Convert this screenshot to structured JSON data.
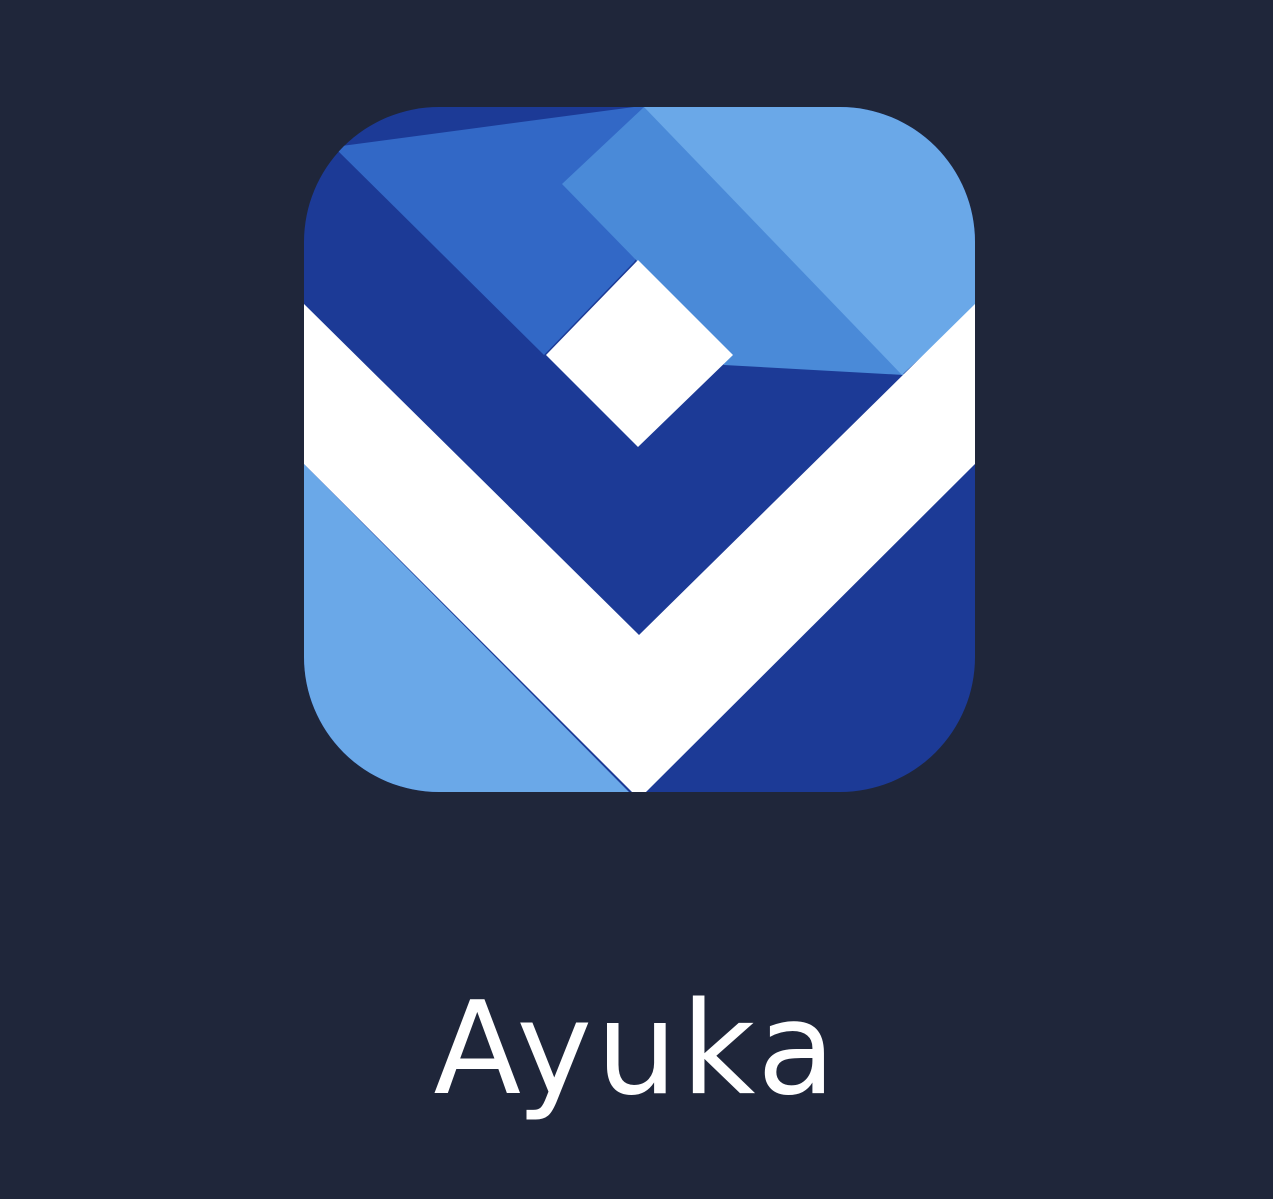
{
  "app": {
    "name": "Ayuka",
    "icon": "ayuka-chevron-logo-icon"
  },
  "colors": {
    "background": "#1f263a",
    "blue_light": "#6aa8e8",
    "blue_mid": "#4a8ad8",
    "blue_medium_dark": "#3268c6",
    "blue_dark": "#1c3a96",
    "white": "#ffffff",
    "label_text": "#ffffff"
  }
}
